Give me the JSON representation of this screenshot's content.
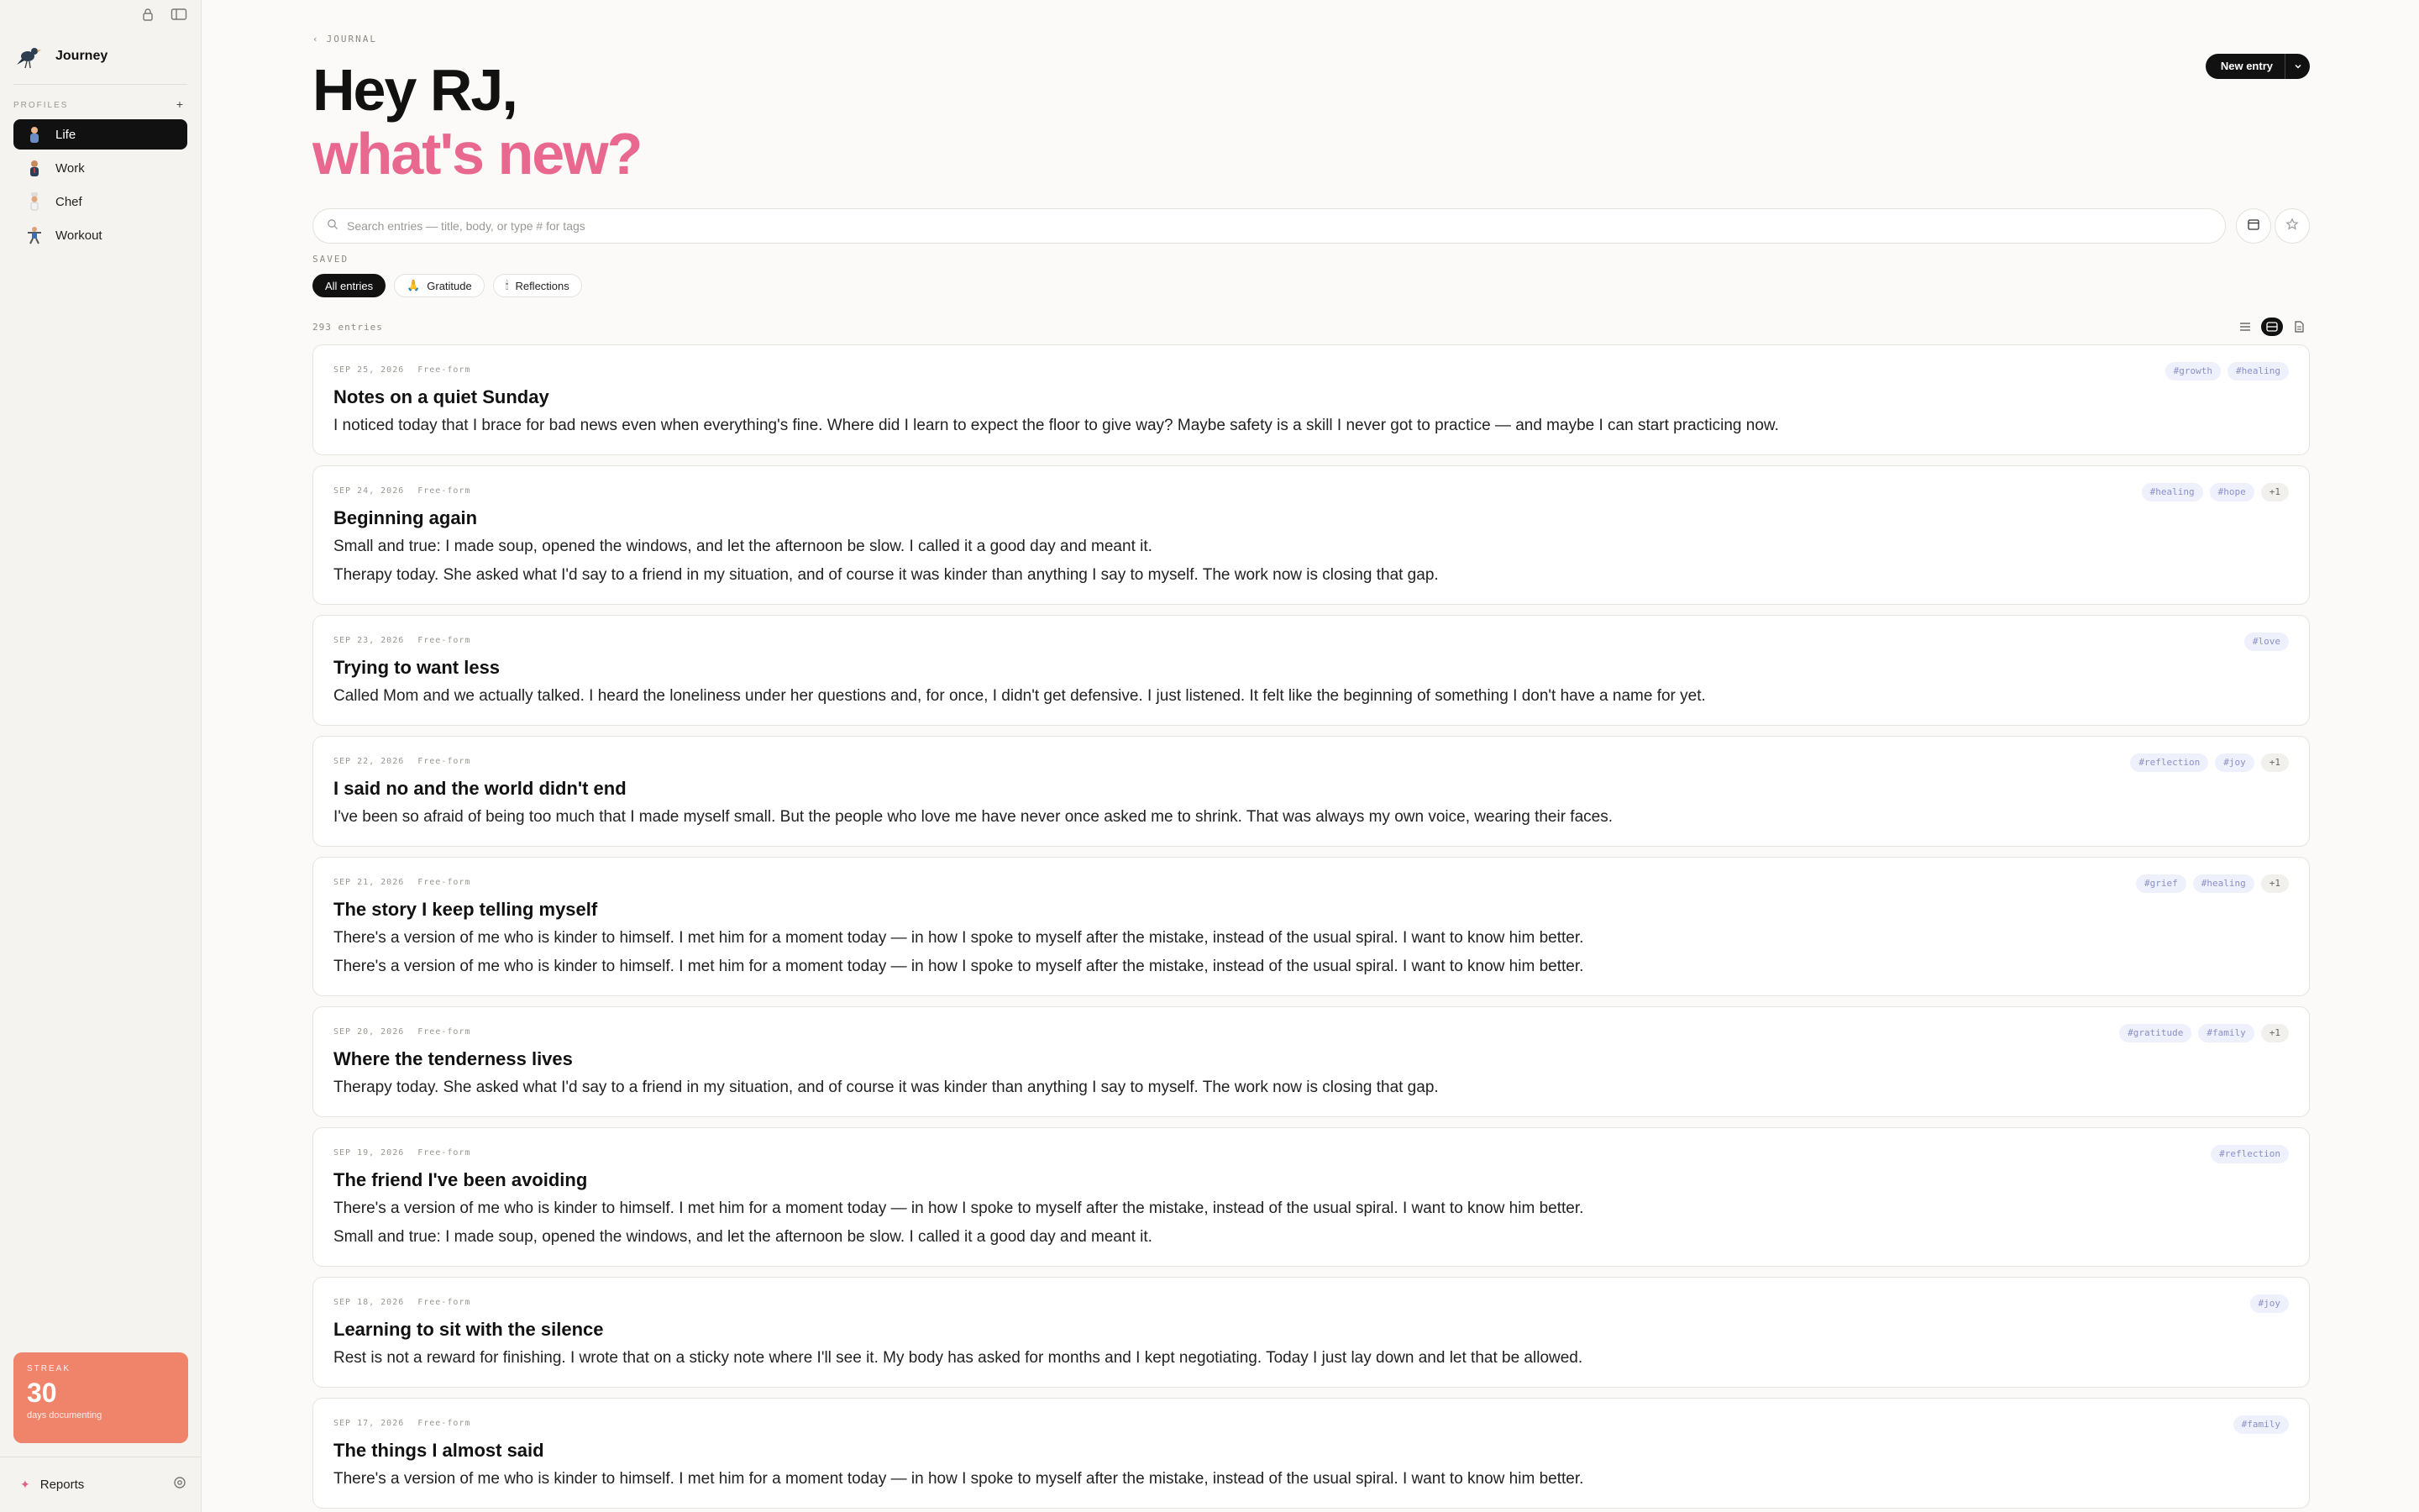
{
  "sidebar": {
    "app_name": "Journey",
    "profiles_label": "PROFILES",
    "add_label": "+",
    "profiles": [
      {
        "label": "Life",
        "icon": "person-life-icon",
        "active": true
      },
      {
        "label": "Work",
        "icon": "person-work-icon",
        "active": false
      },
      {
        "label": "Chef",
        "icon": "person-chef-icon",
        "active": false
      },
      {
        "label": "Workout",
        "icon": "person-workout-icon",
        "active": false
      }
    ],
    "streak": {
      "label": "STREAK",
      "value": "30",
      "sub": "days documenting"
    },
    "reports_label": "Reports"
  },
  "header": {
    "breadcrumb": "JOURNAL",
    "greeting_line1": "Hey RJ,",
    "greeting_line2": "what's new?",
    "new_entry_label": "New entry"
  },
  "search": {
    "placeholder": "Search entries — title, body, or type # for tags"
  },
  "saved": {
    "label": "SAVED",
    "chips": [
      {
        "label": "All entries",
        "icon": "",
        "active": true
      },
      {
        "label": "Gratitude",
        "icon": "🙏",
        "active": false
      },
      {
        "label": "Reflections",
        "icon": "🕯",
        "active": false
      }
    ]
  },
  "entries_count": "293 entries",
  "colors": {
    "accent": "#e8688f",
    "streak": "#f0846a",
    "tag_bg": "#eef0fb",
    "tag_text": "#8a90c9"
  },
  "entries": [
    {
      "date": "SEP 25, 2026",
      "type": "Free-form",
      "title": "Notes on a quiet Sunday",
      "tags": [
        "#growth",
        "#healing"
      ],
      "body": [
        "I noticed today that I brace for bad news even when everything's fine. Where did I learn to expect the floor to give way? Maybe safety is a skill I never got to practice — and maybe I can start practicing now."
      ]
    },
    {
      "date": "SEP 24, 2026",
      "type": "Free-form",
      "title": "Beginning again",
      "tags": [
        "#healing",
        "#hope",
        "+1"
      ],
      "body": [
        "Small and true: I made soup, opened the windows, and let the afternoon be slow. I called it a good day and meant it.",
        "Therapy today. She asked what I'd say to a friend in my situation, and of course it was kinder than anything I say to myself. The work now is closing that gap."
      ]
    },
    {
      "date": "SEP 23, 2026",
      "type": "Free-form",
      "title": "Trying to want less",
      "tags": [
        "#love"
      ],
      "body": [
        "Called Mom and we actually talked. I heard the loneliness under her questions and, for once, I didn't get defensive. I just listened. It felt like the beginning of something I don't have a name for yet."
      ]
    },
    {
      "date": "SEP 22, 2026",
      "type": "Free-form",
      "title": "I said no and the world didn't end",
      "tags": [
        "#reflection",
        "#joy",
        "+1"
      ],
      "body": [
        "I've been so afraid of being too much that I made myself small. But the people who love me have never once asked me to shrink. That was always my own voice, wearing their faces."
      ]
    },
    {
      "date": "SEP 21, 2026",
      "type": "Free-form",
      "title": "The story I keep telling myself",
      "tags": [
        "#grief",
        "#healing",
        "+1"
      ],
      "body": [
        "There's a version of me who is kinder to himself. I met him for a moment today — in how I spoke to myself after the mistake, instead of the usual spiral. I want to know him better.",
        "There's a version of me who is kinder to himself. I met him for a moment today — in how I spoke to myself after the mistake, instead of the usual spiral. I want to know him better."
      ]
    },
    {
      "date": "SEP 20, 2026",
      "type": "Free-form",
      "title": "Where the tenderness lives",
      "tags": [
        "#gratitude",
        "#family",
        "+1"
      ],
      "body": [
        "Therapy today. She asked what I'd say to a friend in my situation, and of course it was kinder than anything I say to myself. The work now is closing that gap."
      ]
    },
    {
      "date": "SEP 19, 2026",
      "type": "Free-form",
      "title": "The friend I've been avoiding",
      "tags": [
        "#reflection"
      ],
      "body": [
        "There's a version of me who is kinder to himself. I met him for a moment today — in how I spoke to myself after the mistake, instead of the usual spiral. I want to know him better.",
        "Small and true: I made soup, opened the windows, and let the afternoon be slow. I called it a good day and meant it."
      ]
    },
    {
      "date": "SEP 18, 2026",
      "type": "Free-form",
      "title": "Learning to sit with the silence",
      "tags": [
        "#joy"
      ],
      "body": [
        "Rest is not a reward for finishing. I wrote that on a sticky note where I'll see it. My body has asked for months and I kept negotiating. Today I just lay down and let that be allowed."
      ]
    },
    {
      "date": "SEP 17, 2026",
      "type": "Free-form",
      "title": "The things I almost said",
      "tags": [
        "#family"
      ],
      "body": [
        "There's a version of me who is kinder to himself. I met him for a moment today — in how I spoke to myself after the mistake, instead of the usual spiral. I want to know him better."
      ]
    }
  ]
}
